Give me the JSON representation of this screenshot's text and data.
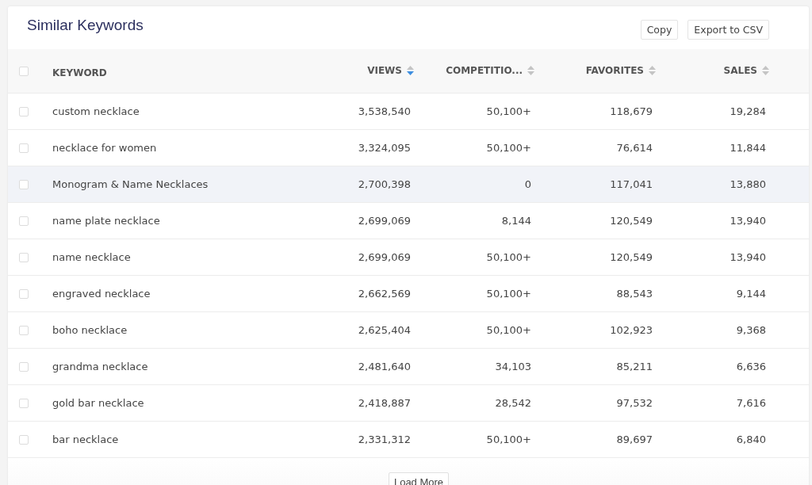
{
  "title": "Similar Keywords",
  "actions": [
    "Copy",
    "Export to CSV"
  ],
  "header_checkbox": {
    "checked": false
  },
  "columns": [
    {
      "label": "KEYWORD",
      "kind": "text"
    },
    {
      "label": "VIEWS",
      "kind": "number",
      "sorted": true
    },
    {
      "label": "COMPETITIO...",
      "kind": "number",
      "sorted": false
    },
    {
      "label": "FAVORITES",
      "kind": "number",
      "sorted": false
    },
    {
      "label": "SALES",
      "kind": "number",
      "sorted": false
    }
  ],
  "rows": [
    {
      "checked": false,
      "highlighted": false,
      "cells": [
        "custom necklace",
        "3,538,540",
        "50,100+",
        "118,679",
        "19,284"
      ]
    },
    {
      "checked": false,
      "highlighted": false,
      "cells": [
        "necklace for women",
        "3,324,095",
        "50,100+",
        "76,614",
        "11,844"
      ]
    },
    {
      "checked": false,
      "highlighted": true,
      "cells": [
        "Monogram & Name Necklaces",
        "2,700,398",
        "0",
        "117,041",
        "13,880"
      ]
    },
    {
      "checked": false,
      "highlighted": false,
      "cells": [
        "name plate necklace",
        "2,699,069",
        "8,144",
        "120,549",
        "13,940"
      ]
    },
    {
      "checked": false,
      "highlighted": false,
      "cells": [
        "name necklace",
        "2,699,069",
        "50,100+",
        "120,549",
        "13,940"
      ]
    },
    {
      "checked": false,
      "highlighted": false,
      "cells": [
        "engraved necklace",
        "2,662,569",
        "50,100+",
        "88,543",
        "9,144"
      ]
    },
    {
      "checked": false,
      "highlighted": false,
      "cells": [
        "boho necklace",
        "2,625,404",
        "50,100+",
        "102,923",
        "9,368"
      ]
    },
    {
      "checked": false,
      "highlighted": false,
      "cells": [
        "grandma necklace",
        "2,481,640",
        "34,103",
        "85,211",
        "6,636"
      ]
    },
    {
      "checked": false,
      "highlighted": false,
      "cells": [
        "gold bar necklace",
        "2,418,887",
        "28,542",
        "97,532",
        "7,616"
      ]
    },
    {
      "checked": false,
      "highlighted": false,
      "cells": [
        "bar necklace",
        "2,331,312",
        "50,100+",
        "89,697",
        "6,840"
      ]
    }
  ],
  "load_more": "Load More"
}
